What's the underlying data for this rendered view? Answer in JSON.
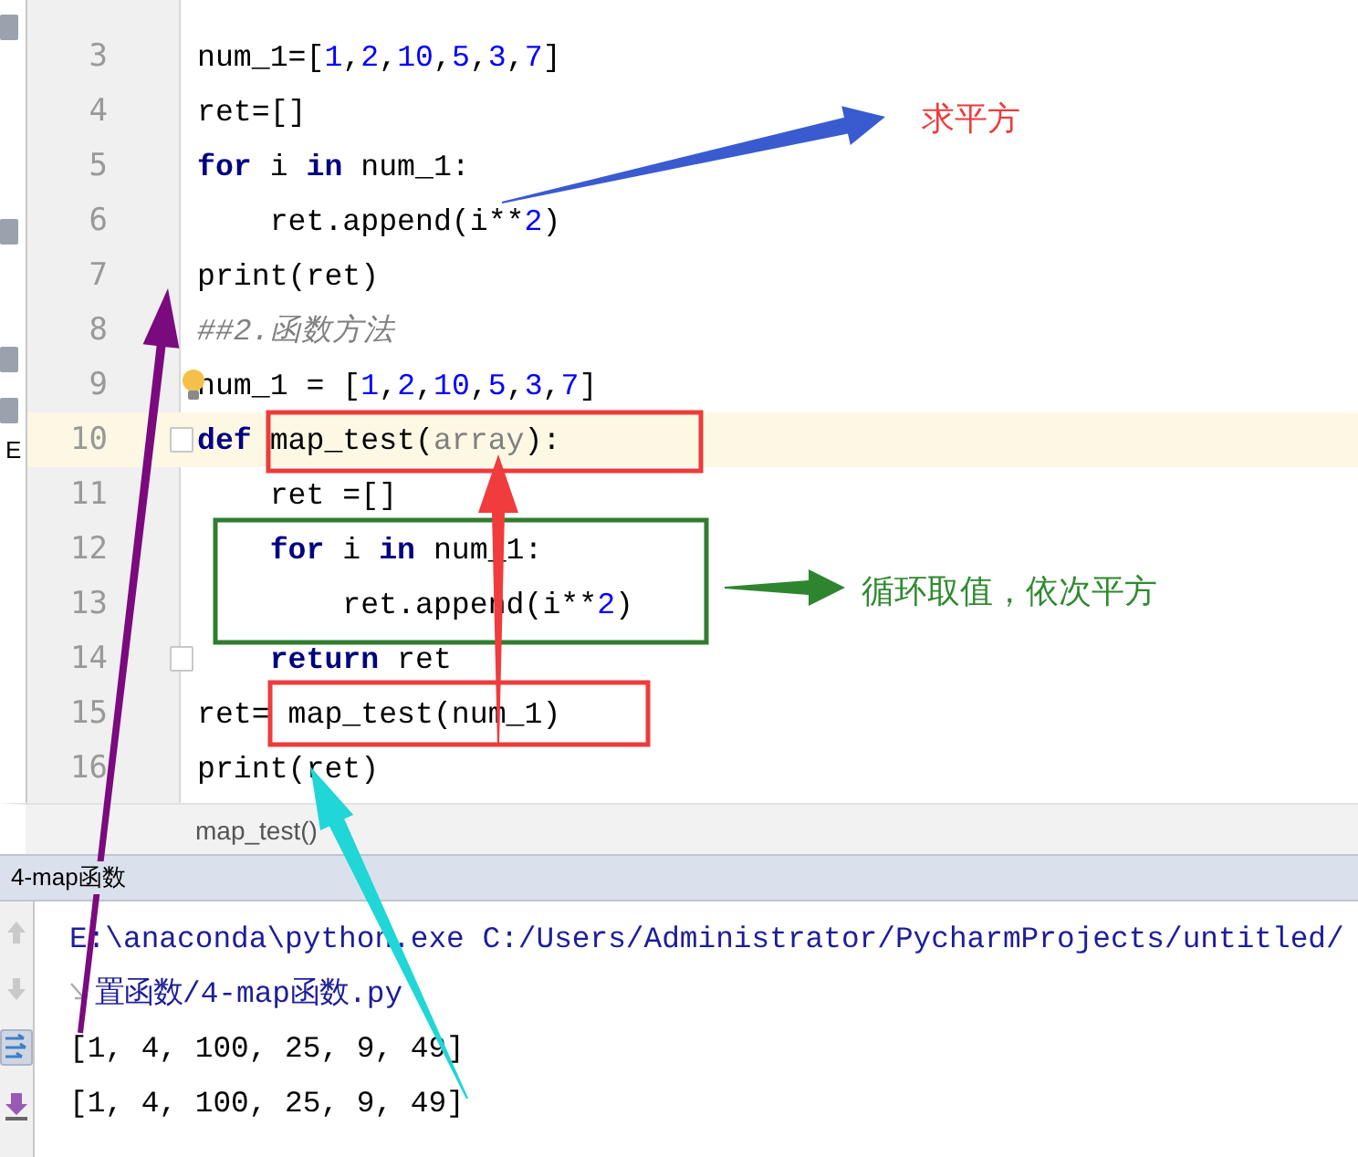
{
  "editor": {
    "lines": [
      {
        "number": "3",
        "highlighted": false,
        "fold": false,
        "tokens": [
          {
            "text": "num_1=[",
            "kind": "plain"
          },
          {
            "text": "1",
            "kind": "number"
          },
          {
            "text": ",",
            "kind": "plain"
          },
          {
            "text": "2",
            "kind": "number"
          },
          {
            "text": ",",
            "kind": "plain"
          },
          {
            "text": "10",
            "kind": "number"
          },
          {
            "text": ",",
            "kind": "plain"
          },
          {
            "text": "5",
            "kind": "number"
          },
          {
            "text": ",",
            "kind": "plain"
          },
          {
            "text": "3",
            "kind": "number"
          },
          {
            "text": ",",
            "kind": "plain"
          },
          {
            "text": "7",
            "kind": "number"
          },
          {
            "text": "]",
            "kind": "plain"
          }
        ]
      },
      {
        "number": "4",
        "highlighted": false,
        "fold": false,
        "tokens": [
          {
            "text": "ret=[]",
            "kind": "plain"
          }
        ]
      },
      {
        "number": "5",
        "highlighted": false,
        "fold": false,
        "tokens": [
          {
            "text": "for",
            "kind": "keyword"
          },
          {
            "text": " i ",
            "kind": "plain"
          },
          {
            "text": "in",
            "kind": "keyword"
          },
          {
            "text": " num_1:",
            "kind": "plain"
          }
        ]
      },
      {
        "number": "6",
        "highlighted": false,
        "fold": false,
        "tokens": [
          {
            "text": "    ret.append(i**",
            "kind": "plain"
          },
          {
            "text": "2",
            "kind": "number"
          },
          {
            "text": ")",
            "kind": "plain"
          }
        ]
      },
      {
        "number": "7",
        "highlighted": false,
        "fold": false,
        "tokens": [
          {
            "text": "print(ret)",
            "kind": "plain"
          }
        ]
      },
      {
        "number": "8",
        "highlighted": false,
        "fold": false,
        "tokens": [
          {
            "text": "##2.函数方法",
            "kind": "comment"
          }
        ]
      },
      {
        "number": "9",
        "highlighted": false,
        "fold": false,
        "tokens": [
          {
            "text": "num_1 = [",
            "kind": "plain"
          },
          {
            "text": "1",
            "kind": "number"
          },
          {
            "text": ",",
            "kind": "plain"
          },
          {
            "text": "2",
            "kind": "number"
          },
          {
            "text": ",",
            "kind": "plain"
          },
          {
            "text": "10",
            "kind": "number"
          },
          {
            "text": ",",
            "kind": "plain"
          },
          {
            "text": "5",
            "kind": "number"
          },
          {
            "text": ",",
            "kind": "plain"
          },
          {
            "text": "3",
            "kind": "number"
          },
          {
            "text": ",",
            "kind": "plain"
          },
          {
            "text": "7",
            "kind": "number"
          },
          {
            "text": "]",
            "kind": "plain"
          }
        ]
      },
      {
        "number": "10",
        "highlighted": true,
        "fold": true,
        "tokens": [
          {
            "text": "def",
            "kind": "keyword"
          },
          {
            "text": " map_test(",
            "kind": "plain"
          },
          {
            "text": "array",
            "kind": "param"
          },
          {
            "text": "):",
            "kind": "plain"
          }
        ]
      },
      {
        "number": "11",
        "highlighted": false,
        "fold": false,
        "tokens": [
          {
            "text": "    ret =[]",
            "kind": "plain"
          }
        ]
      },
      {
        "number": "12",
        "highlighted": false,
        "fold": false,
        "tokens": [
          {
            "text": "    for",
            "kind": "keyword"
          },
          {
            "text": " i ",
            "kind": "plain"
          },
          {
            "text": "in",
            "kind": "keyword"
          },
          {
            "text": " num_1:",
            "kind": "plain"
          }
        ]
      },
      {
        "number": "13",
        "highlighted": false,
        "fold": false,
        "tokens": [
          {
            "text": "        ret.append(i**",
            "kind": "plain"
          },
          {
            "text": "2",
            "kind": "number"
          },
          {
            "text": ")",
            "kind": "plain"
          }
        ]
      },
      {
        "number": "14",
        "highlighted": false,
        "fold": true,
        "tokens": [
          {
            "text": "    return",
            "kind": "keyword"
          },
          {
            "text": " ret",
            "kind": "plain"
          }
        ]
      },
      {
        "number": "15",
        "highlighted": false,
        "fold": false,
        "tokens": [
          {
            "text": "ret= map_test(num_1)",
            "kind": "plain"
          }
        ]
      },
      {
        "number": "16",
        "highlighted": false,
        "fold": false,
        "tokens": [
          {
            "text": "print(ret)",
            "kind": "plain"
          }
        ]
      }
    ],
    "side_label": "E",
    "breadcrumb": "map_test()"
  },
  "run_panel": {
    "title": "4-map函数",
    "toolbar": [
      {
        "kind": "up",
        "selected": false
      },
      {
        "kind": "down",
        "selected": false
      },
      {
        "kind": "wrap",
        "selected": true
      },
      {
        "kind": "scroll-end",
        "selected": false
      }
    ],
    "output": [
      {
        "text": "E:\\anaconda\\python.exe C:/Users/Administrator/PycharmProjects/untitled/",
        "kind": "command",
        "wrapped": false
      },
      {
        "text": "置函数/4-map函数.py",
        "kind": "command",
        "wrapped": true
      },
      {
        "text": "[1, 4, 100, 25, 9, 49]",
        "kind": "stdout",
        "wrapped": false
      },
      {
        "text": "[1, 4, 100, 25, 9, 49]",
        "kind": "stdout",
        "wrapped": false
      }
    ]
  },
  "annotations": [
    {
      "text": "求平方",
      "color": "#ee3b3b"
    },
    {
      "text": "循环取值，依次平方",
      "color": "#2f8a2f"
    }
  ]
}
